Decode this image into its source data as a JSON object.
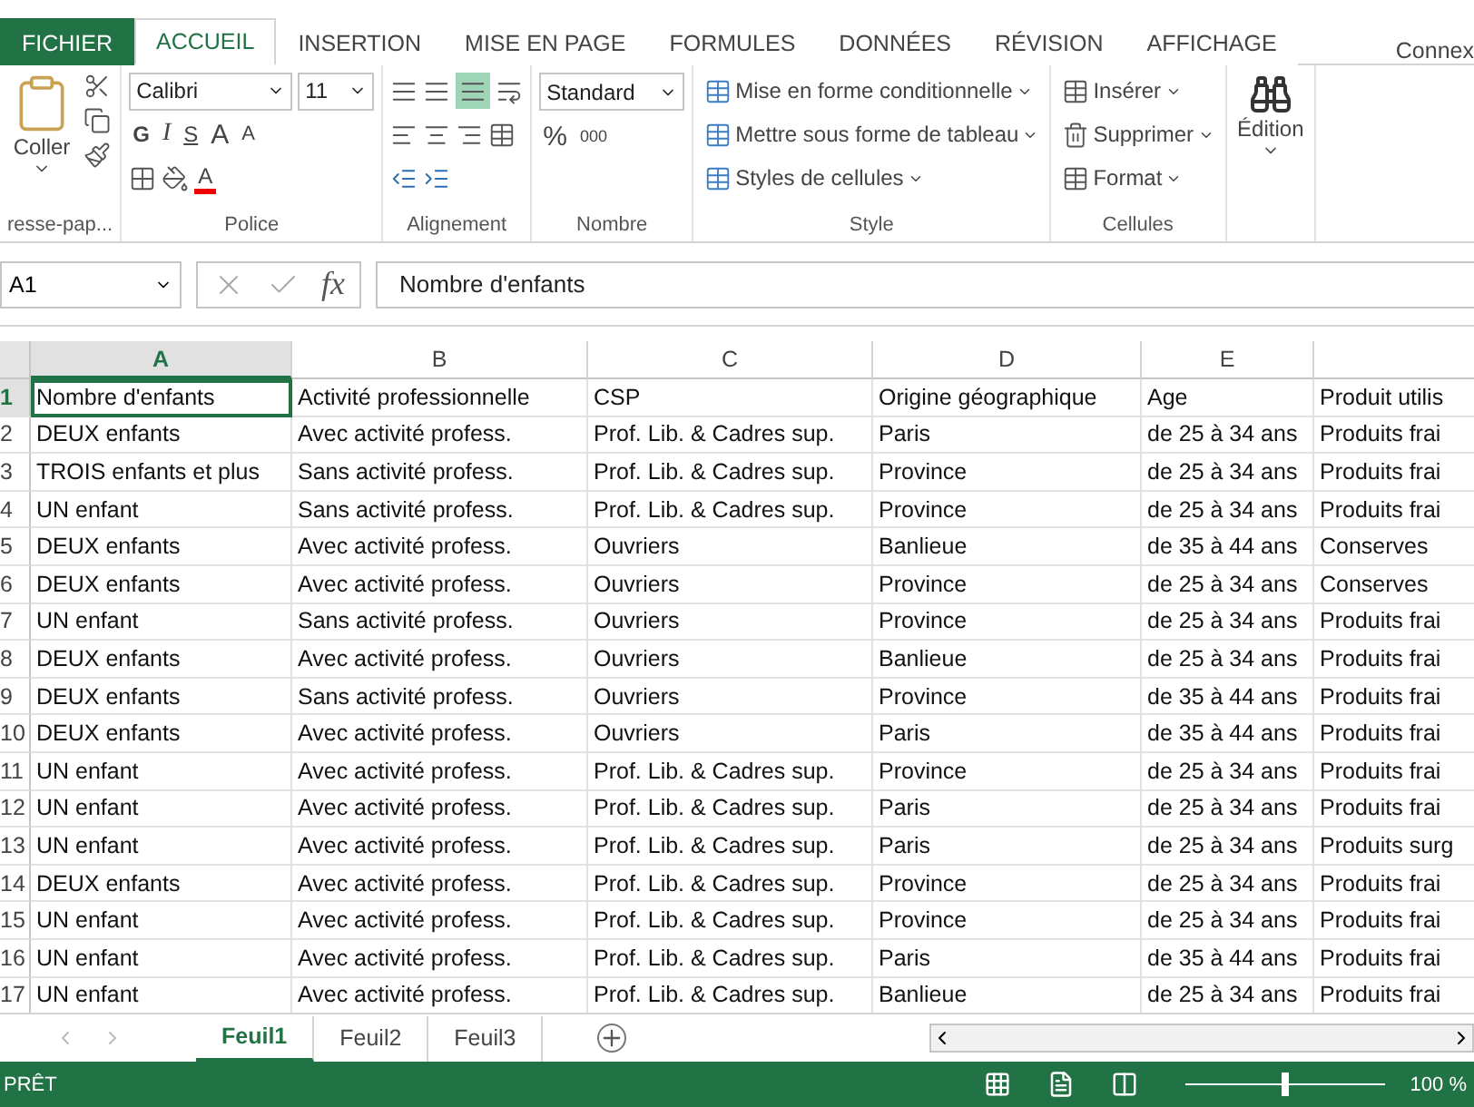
{
  "ribbon_tabs": [
    {
      "label": "FICHIER",
      "kind": "file",
      "selected": false
    },
    {
      "label": "ACCUEIL",
      "kind": "tab",
      "selected": true
    },
    {
      "label": "INSERTION",
      "kind": "tab",
      "selected": false
    },
    {
      "label": "MISE EN PAGE",
      "kind": "tab",
      "selected": false
    },
    {
      "label": "FORMULES",
      "kind": "tab",
      "selected": false
    },
    {
      "label": "DONNÉES",
      "kind": "tab",
      "selected": false
    },
    {
      "label": "RÉVISION",
      "kind": "tab",
      "selected": false
    },
    {
      "label": "AFFICHAGE",
      "kind": "tab",
      "selected": false
    }
  ],
  "account": "Connex",
  "clipboard": {
    "paste": "Coller",
    "label": "resse-pap..."
  },
  "font": {
    "name": "Calibri",
    "size": "11",
    "bold": "G",
    "italic": "I",
    "underline": "S",
    "grow": "A",
    "shrink": "A",
    "color_letter": "A",
    "label": "Police"
  },
  "alignment": {
    "label": "Alignement"
  },
  "number": {
    "format": "Standard",
    "percent": "%",
    "thousands": "000",
    "label": "Nombre"
  },
  "style": {
    "items": [
      "Mise en forme conditionnelle",
      "Mettre sous forme de tableau",
      "Styles de cellules"
    ],
    "label": "Style"
  },
  "cells": {
    "items": [
      "Insérer",
      "Supprimer",
      "Format"
    ],
    "label": "Cellules"
  },
  "editing": {
    "label": "Édition"
  },
  "formula_bar": {
    "cell_ref": "A1",
    "fx": "fx",
    "formula": "Nombre d'enfants"
  },
  "columns": [
    {
      "letter": "A",
      "selected": true
    },
    {
      "letter": "B",
      "selected": false
    },
    {
      "letter": "C",
      "selected": false
    },
    {
      "letter": "D",
      "selected": false
    },
    {
      "letter": "E",
      "selected": false
    }
  ],
  "rows": [
    {
      "number": "1",
      "cells": [
        "Nombre d'enfants",
        "Activité professionnelle",
        "CSP",
        "Origine géographique",
        "Age",
        "Produit utilis"
      ]
    },
    {
      "number": "2",
      "cells": [
        "DEUX enfants",
        "Avec activité profess.",
        "Prof. Lib. & Cadres sup.",
        "Paris",
        "de 25 à 34 ans",
        "Produits frai"
      ]
    },
    {
      "number": "3",
      "cells": [
        "TROIS enfants et plus",
        "Sans activité profess.",
        "Prof. Lib. & Cadres sup.",
        "Province",
        "de 25 à 34 ans",
        "Produits frai"
      ]
    },
    {
      "number": "4",
      "cells": [
        "UN enfant",
        "Sans activité profess.",
        "Prof. Lib. & Cadres sup.",
        "Province",
        "de 25 à 34 ans",
        "Produits frai"
      ]
    },
    {
      "number": "5",
      "cells": [
        "DEUX enfants",
        "Avec activité profess.",
        "Ouvriers",
        "Banlieue",
        "de 35 à 44 ans",
        "Conserves"
      ]
    },
    {
      "number": "6",
      "cells": [
        "DEUX enfants",
        "Avec activité profess.",
        "Ouvriers",
        "Province",
        "de 25 à 34 ans",
        "Conserves"
      ]
    },
    {
      "number": "7",
      "cells": [
        "UN enfant",
        "Sans activité profess.",
        "Ouvriers",
        "Province",
        "de 25 à 34 ans",
        "Produits frai"
      ]
    },
    {
      "number": "8",
      "cells": [
        "DEUX enfants",
        "Avec activité profess.",
        "Ouvriers",
        "Banlieue",
        "de 25 à 34 ans",
        "Produits frai"
      ]
    },
    {
      "number": "9",
      "cells": [
        "DEUX enfants",
        "Sans activité profess.",
        "Ouvriers",
        "Province",
        "de 35 à 44 ans",
        "Produits frai"
      ]
    },
    {
      "number": "10",
      "cells": [
        "DEUX enfants",
        "Avec activité profess.",
        "Ouvriers",
        "Paris",
        "de 35 à 44 ans",
        "Produits frai"
      ]
    },
    {
      "number": "11",
      "cells": [
        "UN enfant",
        "Avec activité profess.",
        "Prof. Lib. & Cadres sup.",
        "Province",
        "de 25 à 34 ans",
        "Produits frai"
      ]
    },
    {
      "number": "12",
      "cells": [
        "UN enfant",
        "Avec activité profess.",
        "Prof. Lib. & Cadres sup.",
        "Paris",
        "de 25 à 34 ans",
        "Produits frai"
      ]
    },
    {
      "number": "13",
      "cells": [
        "UN enfant",
        "Avec activité profess.",
        "Prof. Lib. & Cadres sup.",
        "Paris",
        "de 25 à 34 ans",
        "Produits surg"
      ]
    },
    {
      "number": "14",
      "cells": [
        "DEUX enfants",
        "Avec activité profess.",
        "Prof. Lib. & Cadres sup.",
        "Province",
        "de 25 à 34 ans",
        "Produits frai"
      ]
    },
    {
      "number": "15",
      "cells": [
        "UN enfant",
        "Avec activité profess.",
        "Prof. Lib. & Cadres sup.",
        "Province",
        "de 25 à 34 ans",
        "Produits frai"
      ]
    },
    {
      "number": "16",
      "cells": [
        "UN enfant",
        "Avec activité profess.",
        "Prof. Lib. & Cadres sup.",
        "Paris",
        "de 35 à 44 ans",
        "Produits frai"
      ]
    },
    {
      "number": "17",
      "cells": [
        "UN enfant",
        "Avec activité profess.",
        "Prof. Lib. & Cadres sup.",
        "Banlieue",
        "de 25 à 34 ans",
        "Produits frai"
      ]
    }
  ],
  "sheet_tabs": [
    {
      "label": "Feuil1",
      "selected": true
    },
    {
      "label": "Feuil2",
      "selected": false
    },
    {
      "label": "Feuil3",
      "selected": false
    }
  ],
  "status_bar": {
    "status": "PRÊT",
    "zoom_slider": {
      "level": 0.5
    },
    "zoom": "100 %"
  }
}
